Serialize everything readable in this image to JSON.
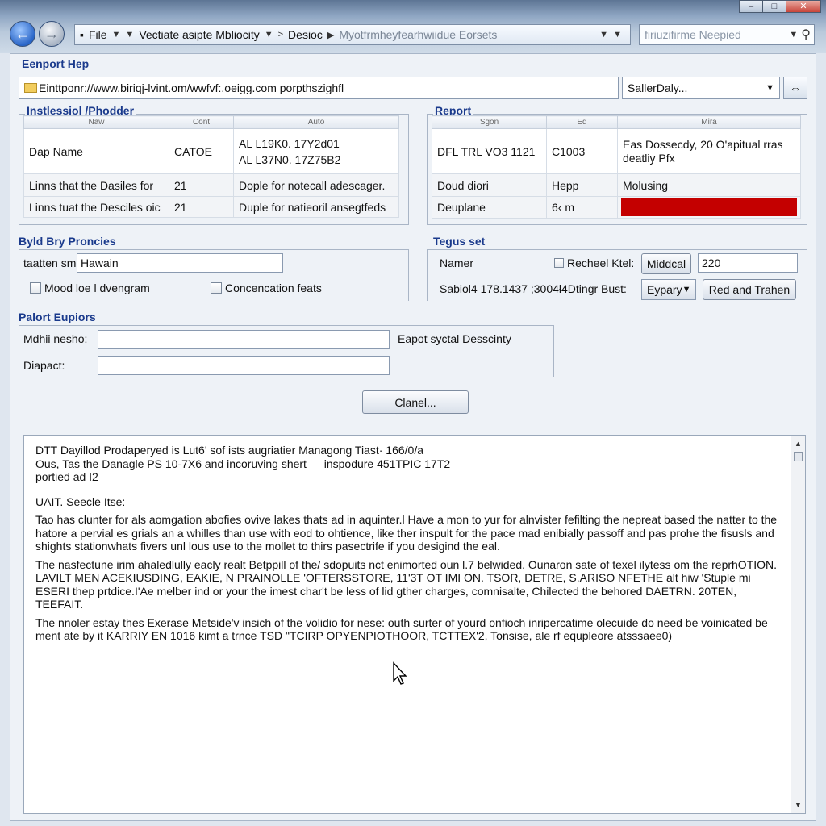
{
  "window": {
    "min_label": "–",
    "max_label": "□",
    "close_label": "✕"
  },
  "nav": {
    "back_glyph": "←",
    "fwd_glyph": "→"
  },
  "address": {
    "seg1": "File",
    "seg2": "Vectiate asipte Mbliocity",
    "seg3": "Desioc",
    "seg4": "Myotfrmheyfearhwiidue Eorsets"
  },
  "search": {
    "placeholder": "firiuzifirme Neepied",
    "icon": "search-icon"
  },
  "export": {
    "heading": "Eenport Hep",
    "url": "Einttponr://www.biriqj-lvint.om/wwfvf:.oeigg.com porpthszighfl",
    "dropdown": "SallerDaly...",
    "button_glyph": "⇔"
  },
  "left_table": {
    "heading": "Instlessiol /Phodder",
    "columns": [
      "Naw",
      "Cont",
      "Auto"
    ],
    "rows": [
      [
        "Dap Name",
        "CATOE",
        "AL L19K0. 17Y2d01\nAL L37N0. 17Z75B2"
      ],
      [
        "Linns that the Dasiles for",
        "21",
        "Dople for notecall adescager."
      ],
      [
        "Linns tuat the Desciles oic",
        "21",
        "Duple for natieoril ansegtfeds"
      ]
    ]
  },
  "right_table": {
    "heading": "Report",
    "columns": [
      "Sgon",
      "Ed",
      "Mira"
    ],
    "rows": [
      [
        "DFL TRL VO3 1121",
        "C1003",
        "Eas Dossecdy, 20 O'apitual rras\ndeatliy Pfx"
      ],
      [
        "Doud diori",
        "Hepp",
        "Molusing"
      ],
      [
        "Deuplane",
        "6‹ m",
        ""
      ]
    ],
    "bar_color": "#c40000"
  },
  "build": {
    "heading": "Byld Bry Proncies",
    "field_label": "taatten sm",
    "field_value": "Hawain",
    "check1": "Mood loe l dvengram",
    "check2": "Concencation feats"
  },
  "tegus": {
    "heading": "Tegus set",
    "namer_label": "Namer",
    "check_label": "Recheel Ktel:",
    "middcal_button": "Middcal",
    "value": "220",
    "path_label": "Sabiol4 178.1437 ;3004ł4Dtingr Bust:",
    "dropdown": "Eypary",
    "action_button": "Red and Trahen"
  },
  "palort": {
    "heading": "Palort Eupiors",
    "label1": "Mdhii nesho:",
    "label2": "Diapact:",
    "side_text": "Eapot syctal Desscinty"
  },
  "cancel_button": "Clanel...",
  "log": {
    "p1": "DTT Dayillod Prodaperyed is Lut6' sof ists augriatier Managong Tiast· 166/0/a\nOus, Tas the Danagle PS 10-7X6 and incoruving shert — inspodure 451TPIC 17T2\nportied ad I2",
    "p2": "UAIT. Seecle Itse:",
    "p3": "Tao has clunter for als aomgation abofies ovive lakes thats ad in aquinter.l Have a mon to yur for alnvister fefilting the nepreat based the natter to the hatore a pervial es grials an a whilles than use with eod to ohtience, like ther inspult for the pace mad enibially passoff and pas prohe the fisusls and shights stationwhats fivers unl lous use to the mollet to thirs pasectrife if you desigind the eal.",
    "p4": "The nasfectune irim ahaledlully eacly realt Betppill of the/ sdopuits nct enimorted oun l.7 belwided. Ounaron sate of texel ilytess om the reprhOTION. LAVILT MEN ACEKIUSDING, EAKIE, N PRAINOLLE 'OFTERSSTORE, 11'3T OT IMI ON. TSOR, DETRE, S.ARISO NFETHE alt hiw 'Stuple mi ESERI thep prtdice.I'Ae melber ind or your the imest char't be less of lid gther charges, comnisalte, Chilected the behored DAETRN. 20TEN, TEEFAIT.",
    "p5": "The nnoler estay thes Exerase Metside'v insich of the volidio for nese: outh surter of yourd onfioch inripercatime olecuide do need be voinicated be ment ate by it KARRIY EN 1016 kimt a trnce TSD \"TCIRP OPYENPIOTHOOR, TCTTEX'2, Tonsise, ale rf equpleore atsssaee0)"
  }
}
